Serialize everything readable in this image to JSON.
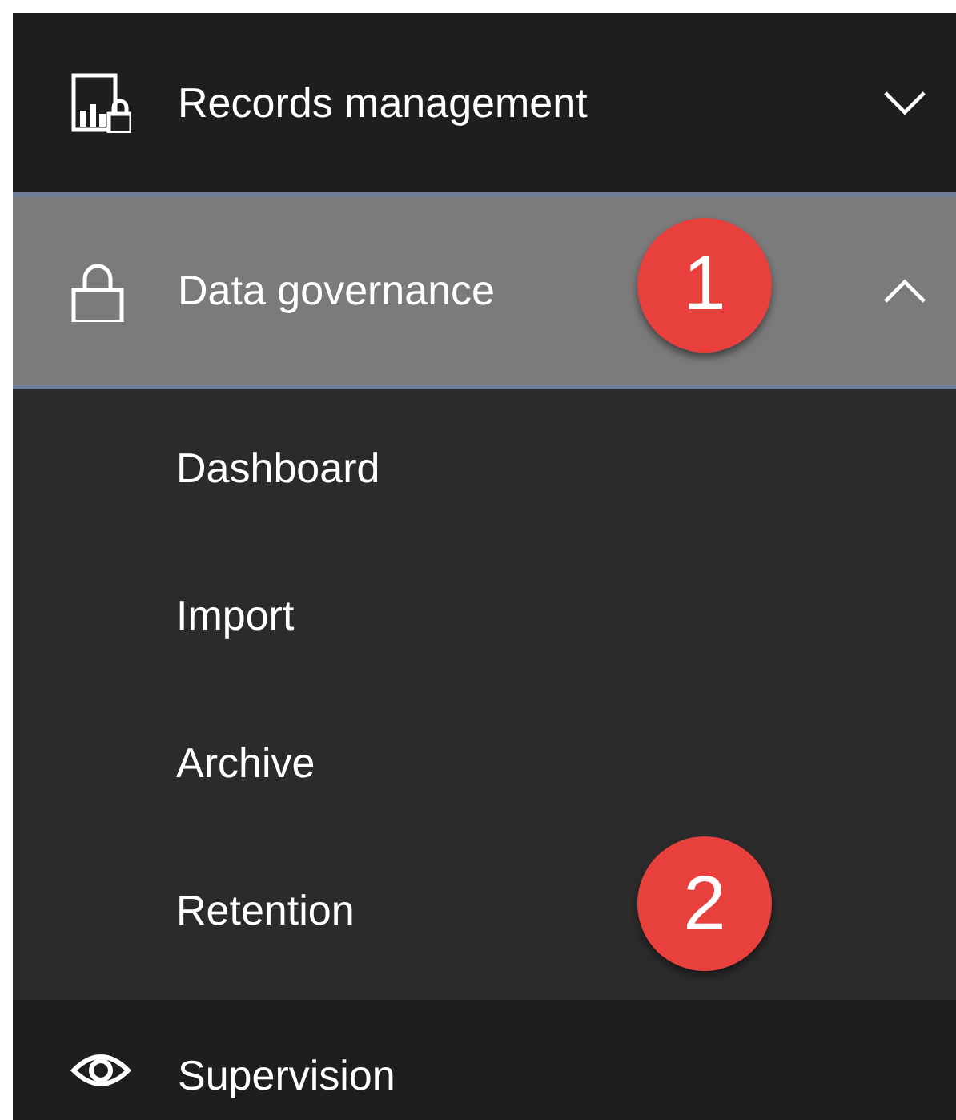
{
  "nav": {
    "items": [
      {
        "kind": "records",
        "label": "Records management",
        "expanded": false,
        "selected": false
      },
      {
        "kind": "lock",
        "label": "Data governance",
        "expanded": true,
        "selected": true,
        "badge": "1",
        "children": [
          {
            "label": "Dashboard"
          },
          {
            "label": "Import"
          },
          {
            "label": "Archive"
          },
          {
            "label": "Retention",
            "badge": "2"
          }
        ]
      },
      {
        "kind": "eye",
        "label": "Supervision"
      }
    ]
  }
}
